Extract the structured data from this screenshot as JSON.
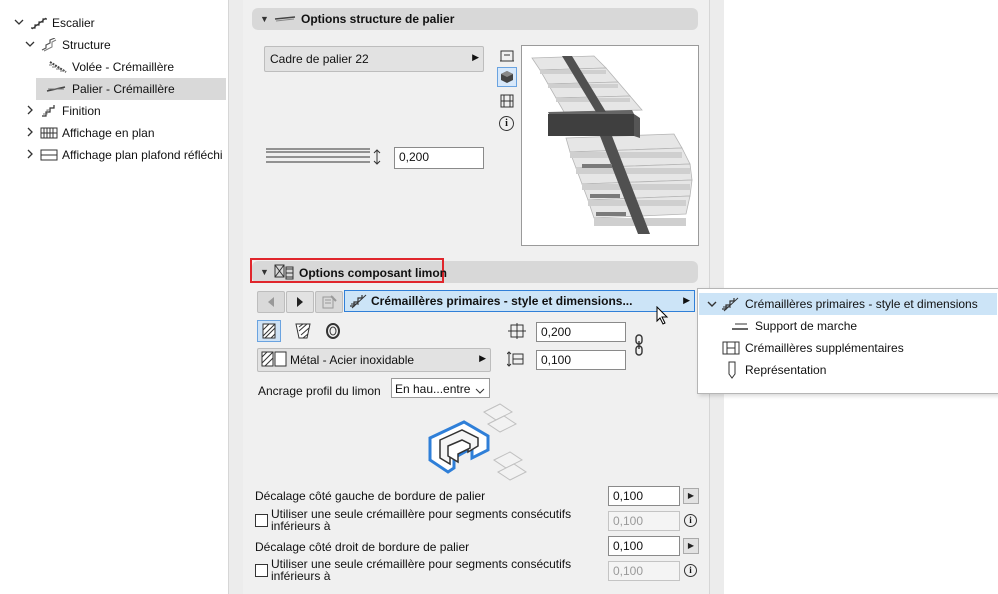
{
  "tree": {
    "items": [
      {
        "label": "Escalier",
        "icon": "stair-icon"
      },
      {
        "label": "Structure",
        "icon": "structure-icon"
      },
      {
        "label": "Volée - Crémaillère",
        "icon": "flight-stringer-icon"
      },
      {
        "label": "Palier - Crémaillère",
        "icon": "landing-stringer-icon"
      },
      {
        "label": "Finition",
        "icon": "finish-icon"
      },
      {
        "label": "Affichage en plan",
        "icon": "floor-plan-icon"
      },
      {
        "label": "Affichage plan plafond réfléchi",
        "icon": "reflected-ceiling-icon"
      }
    ]
  },
  "landing_section": {
    "title": "Options structure de palier",
    "frame_dropdown": "Cadre de palier 22",
    "thickness_value": "0,200"
  },
  "stringer_section": {
    "title": "Options composant limon",
    "component_dropdown": "Crémaillères primaires - style et dimensions...",
    "material_dropdown": "Métal - Acier inoxidable",
    "width_value": "0,200",
    "height_value": "0,100",
    "anchor_label": "Ancrage profil du limon",
    "anchor_value": "En hau...entre",
    "left_offset_label": "Décalage côté gauche de bordure de palier",
    "left_offset_value": "0,100",
    "left_single_label": "Utiliser une seule crémaillère pour segments consécutifs inférieurs à",
    "left_single_value": "0,100",
    "right_offset_label": "Décalage côté droit de bordure de palier",
    "right_offset_value": "0,100",
    "right_single_label": "Utiliser une seule crémaillère pour segments consécutifs inférieurs à",
    "right_single_value": "0,100"
  },
  "popup_menu": {
    "items": [
      {
        "label": "Crémaillères primaires - style et dimensions",
        "checked": true
      },
      {
        "label": "Support de marche",
        "checked": false
      },
      {
        "label": "Crémaillères supplémentaires",
        "checked": false
      },
      {
        "label": "Représentation",
        "checked": false
      }
    ]
  },
  "colors": {
    "highlight_border": "#e0262c",
    "menu_highlight": "#cce4f7",
    "selected_row": "#d9d9d9",
    "blue_accent": "#2f7fd8"
  }
}
